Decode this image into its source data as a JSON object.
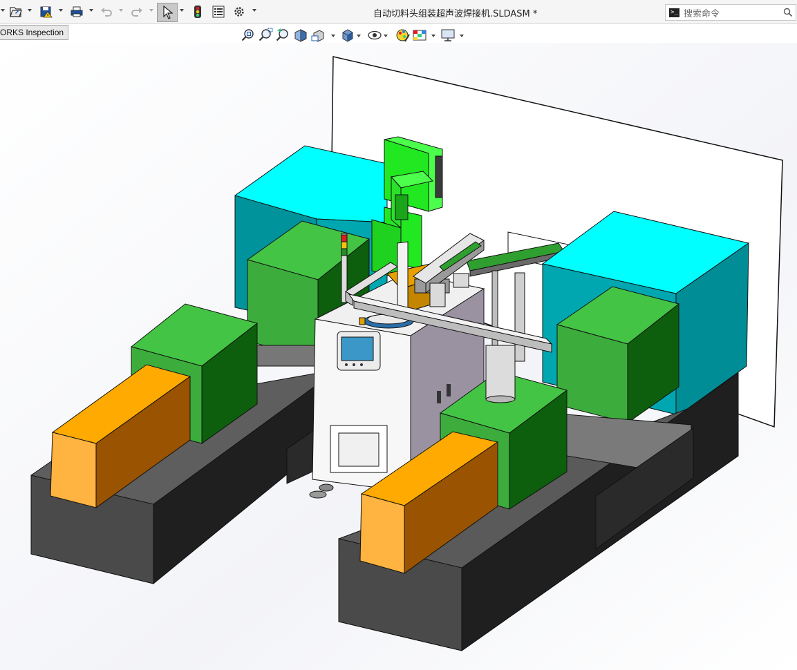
{
  "toolbar": {
    "buttons": [
      {
        "name": "open-icon"
      },
      {
        "name": "save-icon"
      },
      {
        "name": "print-icon"
      },
      {
        "name": "undo-icon"
      },
      {
        "name": "redo-icon"
      },
      {
        "name": "select-icon"
      },
      {
        "name": "rebuild-traffic-light-icon"
      },
      {
        "name": "file-properties-icon"
      },
      {
        "name": "options-gear-icon"
      }
    ]
  },
  "window": {
    "title": "自动切料头组装超声波焊接机.SLDASM *"
  },
  "search": {
    "placeholder": "搜索命令",
    "prompt_glyph": ">_"
  },
  "tab": {
    "label": "ORKS Inspection"
  },
  "view_toolbar": {
    "tools": [
      "zoom-to-fit-icon",
      "zoom-to-area-icon",
      "previous-view-icon",
      "section-view-icon",
      "dynamic-annotation-icon",
      "view-orientation-icon",
      "display-style-icon",
      "hide-show-items-icon",
      "edit-appearance-icon",
      "apply-scene-icon",
      "view-settings-icon"
    ]
  },
  "colors": {
    "toolbar_bg": "#f5f5f5",
    "cyan_guard": "#00ffff",
    "green_block": "#3cb03c",
    "orange_block": "#ffaa00",
    "dark_base": "#404040",
    "bright_green": "#22ff22"
  }
}
